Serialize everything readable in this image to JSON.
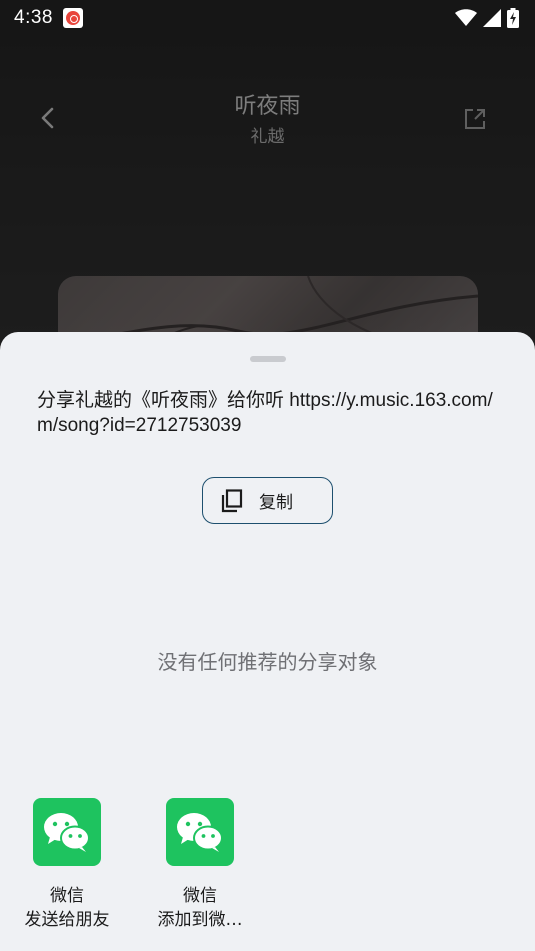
{
  "status_bar": {
    "time": "4:38"
  },
  "player": {
    "song_title": "听夜雨",
    "artist": "礼越"
  },
  "share_sheet": {
    "share_text": "分享礼越的《听夜雨》给你听 https://y.music.163.com/m/song?id=2712753039",
    "copy_label": "复制",
    "empty_message": "没有任何推荐的分享对象",
    "targets": [
      {
        "app": "微信",
        "action": "发送给朋友",
        "icon": "wechat-icon"
      },
      {
        "app": "微信",
        "action": "添加到微…",
        "icon": "wechat-icon"
      }
    ]
  },
  "colors": {
    "sheet_bg": "#eff1f4",
    "wechat_green": "#1ec35f",
    "copy_border": "#1d4f6e"
  }
}
